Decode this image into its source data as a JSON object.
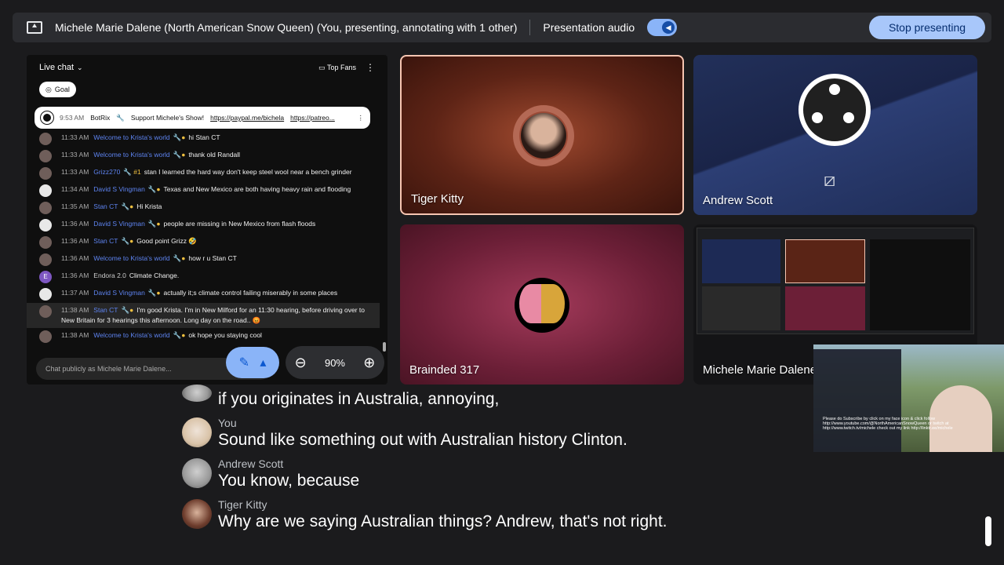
{
  "topbar": {
    "presenter_title": "Michele Marie Dalene (North American Snow Queen) (You, presenting, annotating with 1 other)",
    "audio_label": "Presentation audio",
    "stop_label": "Stop presenting"
  },
  "chat": {
    "title": "Live chat",
    "top_fans": "Top Fans",
    "goal_label": "Goal",
    "pinned": {
      "time": "9:53 AM",
      "author": "BotRix",
      "text": "Support Michele's Show!",
      "link1": "https://paypal.me/bichela",
      "link2": "https://patreo..."
    },
    "messages": [
      {
        "time": "11:33 AM",
        "author": "Welcome to Krista's world",
        "text": "hi Stan CT"
      },
      {
        "time": "11:33 AM",
        "author": "Welcome to Krista's world",
        "text": "thank old Randall"
      },
      {
        "time": "11:33 AM",
        "author": "Grizz270",
        "text": "stan I learned the hard way don't keep steel wool near a bench grinder"
      },
      {
        "time": "11:34 AM",
        "author": "David S Vingman",
        "text": "Texas and New Mexico are both having heavy rain and flooding"
      },
      {
        "time": "11:35 AM",
        "author": "Stan CT",
        "text": "Hi Krista"
      },
      {
        "time": "11:36 AM",
        "author": "David S Vingman",
        "text": "people are missing in New Mexico from flash floods"
      },
      {
        "time": "11:36 AM",
        "author": "Stan CT",
        "text": "Good point Grizz 🤣"
      },
      {
        "time": "11:36 AM",
        "author": "Welcome to Krista's world",
        "text": "how r u Stan CT"
      },
      {
        "time": "11:36 AM",
        "author": "Endora 2.0",
        "text": "Climate Change."
      },
      {
        "time": "11:37 AM",
        "author": "David S Vingman",
        "text": "actually it;s climate control failing miserably in some places"
      },
      {
        "time": "11:38 AM",
        "author": "Stan CT",
        "text": "I'm good Krista. I'm in New Milford for an 11:30 hearing, before driving over to New Britain for 3 hearings this afternoon. Long day on the road.. 😡"
      },
      {
        "time": "11:38 AM",
        "author": "Welcome to Krista's world",
        "text": "ok hope you staying cool"
      }
    ],
    "input_placeholder": "Chat publicly as Michele Marie Dalene..."
  },
  "zoom": {
    "level": "90%"
  },
  "tiles": [
    {
      "name": "Tiger Kitty"
    },
    {
      "name": "Andrew Scott"
    },
    {
      "name": "Brainded 317"
    },
    {
      "name": "Michele Marie Dalene"
    }
  ],
  "webcam": {
    "overlay_text": "Please do Subscribe by click on my face icon & click follow http://www.youtube.com/@NorthAmericanSnowQueen or twitch at http://www.twitch.tv/michele check out my link http://linktr.ee/michele"
  },
  "captions": [
    {
      "speaker": "",
      "text": "if you originates in Australia, annoying,"
    },
    {
      "speaker": "You",
      "text": "Sound like something out with Australian history Clinton."
    },
    {
      "speaker": "Andrew Scott",
      "text": "You know, because"
    },
    {
      "speaker": "Tiger Kitty",
      "text": "Why are we saying Australian things? Andrew, that's not right."
    }
  ]
}
